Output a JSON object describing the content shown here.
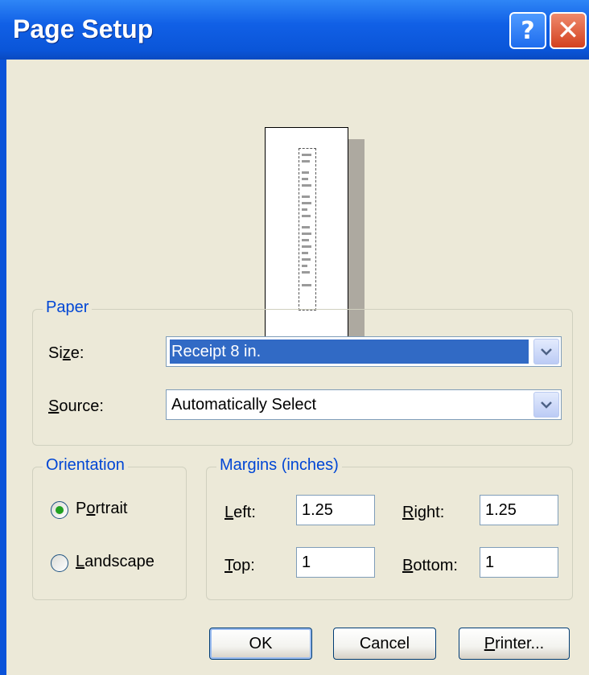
{
  "window": {
    "title": "Page Setup"
  },
  "title_buttons": {
    "help": "?",
    "close": "✕"
  },
  "paper": {
    "group_title": "Paper",
    "size_label_pre": "Si",
    "size_label_accel": "z",
    "size_label_post": "e:",
    "size_value": "Receipt 8 in.",
    "source_label_accel": "S",
    "source_label_post": "ource:",
    "source_value": "Automatically Select"
  },
  "orientation": {
    "group_title": "Orientation",
    "portrait_pre": "P",
    "portrait_accel": "o",
    "portrait_post": "rtrait",
    "landscape_accel": "L",
    "landscape_post": "andscape",
    "selected": "portrait"
  },
  "margins": {
    "group_title": "Margins (inches)",
    "left_accel": "L",
    "left_post": "eft:",
    "left_value": "1.25",
    "right_accel": "R",
    "right_post": "ight:",
    "right_value": "1.25",
    "top_accel": "T",
    "top_post": "op:",
    "top_value": "1",
    "bottom_accel": "B",
    "bottom_post": "ottom:",
    "bottom_value": "1"
  },
  "buttons": {
    "ok": "OK",
    "cancel": "Cancel",
    "printer_accel": "P",
    "printer_post": "rinter..."
  },
  "icons": {
    "dropdown": "chevron-down-icon",
    "help": "help-icon",
    "close": "close-icon"
  },
  "colors": {
    "titlebar": "#0a55d8",
    "dialog_bg": "#ece9d8",
    "group_title": "#0046d5",
    "selection": "#316ac5"
  }
}
